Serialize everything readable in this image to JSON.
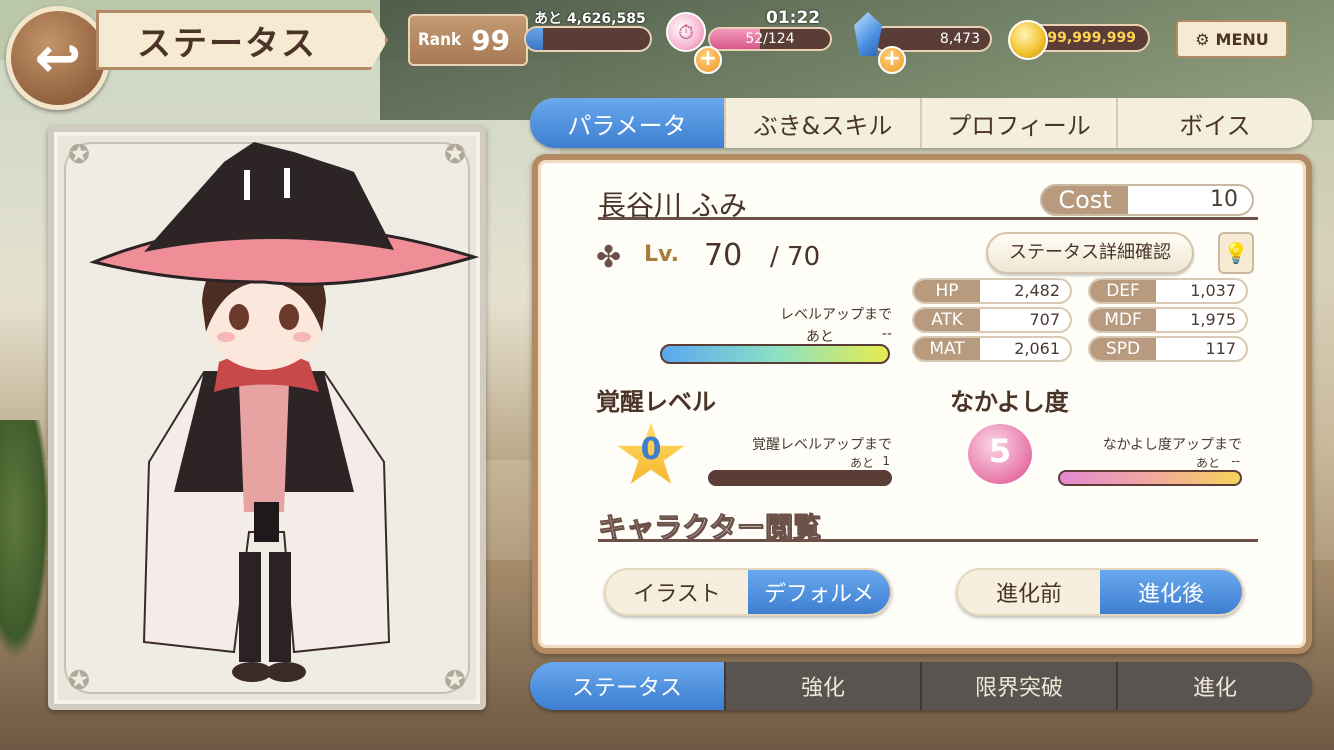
{
  "header": {
    "back_icon": "back-arrow-icon",
    "title": "ステータス",
    "rank_label": "Rank",
    "rank_value": "99",
    "exp_remaining": "あと 4,626,585",
    "exp_progress_percent": 14,
    "timer": "01:22",
    "stamina": "52/124",
    "stamina_progress_percent": 42,
    "gems": "8,473",
    "coins": "99,999,999",
    "menu_label": "MENU"
  },
  "tabs": [
    {
      "label": "パラメータ",
      "active": true
    },
    {
      "label": "ぶき&スキル",
      "active": false
    },
    {
      "label": "プロフィール",
      "active": false
    },
    {
      "label": "ボイス",
      "active": false
    }
  ],
  "character": {
    "name": "長谷川 ふみ",
    "cost_label": "Cost",
    "cost_value": "10",
    "lv_label": "Lv.",
    "level": "70",
    "max_level": "/  70",
    "detail_button": "ステータス詳細確認",
    "levelup_label": "レベルアップまで",
    "levelup_remain_label": "あと",
    "levelup_remain_value": "--",
    "stats": {
      "hp_label": "HP",
      "hp": "2,482",
      "atk_label": "ATK",
      "atk": "707",
      "mat_label": "MAT",
      "mat": "2,061",
      "def_label": "DEF",
      "def": "1,037",
      "mdf_label": "MDF",
      "mdf": "1,975",
      "spd_label": "SPD",
      "spd": "117"
    },
    "awaken_title": "覚醒レベル",
    "awaken_level": "0",
    "awaken_up_label": "覚醒レベルアップまで",
    "awaken_remain_label": "あと",
    "awaken_remain_value": "1",
    "friendship_title": "なかよし度",
    "friendship_level": "5",
    "friendship_up_label": "なかよし度アップまで",
    "friendship_remain_label": "あと",
    "friendship_remain_value": "--"
  },
  "viewer": {
    "title": "キャラクター閲覧",
    "illust_label": "イラスト",
    "deformed_label": "デフォルメ",
    "before_label": "進化前",
    "after_label": "進化後"
  },
  "bottom_tabs": [
    {
      "label": "ステータス",
      "active": true
    },
    {
      "label": "強化",
      "active": false
    },
    {
      "label": "限界突破",
      "active": false
    },
    {
      "label": "進化",
      "active": false
    }
  ],
  "colors": {
    "accent_blue": "#3d7ed0",
    "panel_border": "#b28a63",
    "text_dark": "#4a3428"
  }
}
